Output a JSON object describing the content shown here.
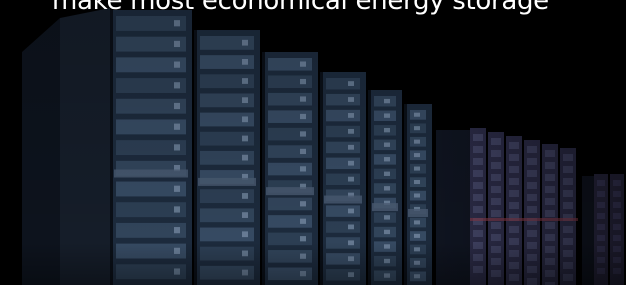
{
  "hero": {
    "headline": "make most economical energy storage",
    "illustration": "battery-storage-racks"
  },
  "colors": {
    "background": "#000000",
    "headline": "#ffffff",
    "rack_front": "#1c2a3c",
    "rack_dark": "#0d131d",
    "module": "#3a4e66",
    "module_far": "#2c2c48"
  }
}
